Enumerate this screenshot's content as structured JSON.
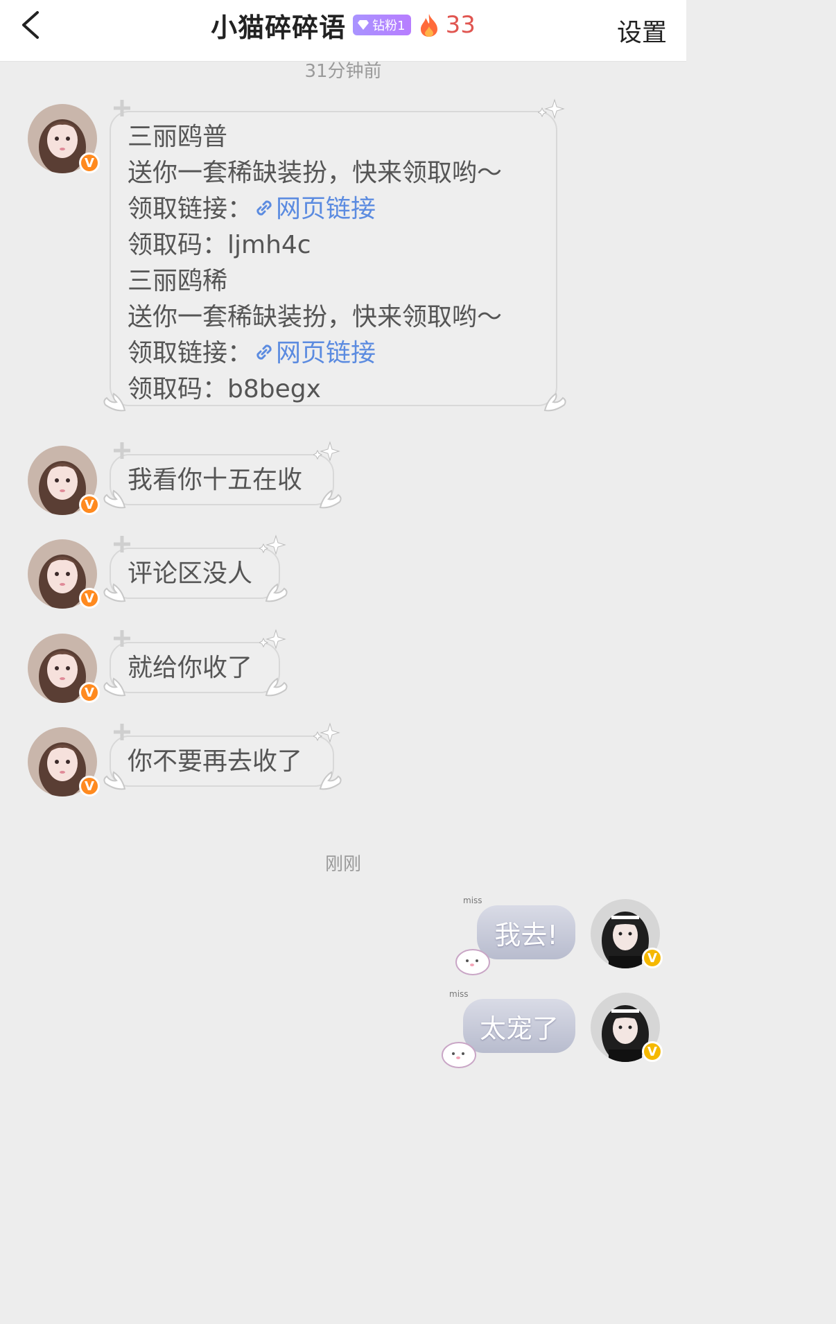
{
  "header": {
    "title": "小猫碎碎语",
    "badge": "钻粉1",
    "streak": "33",
    "settings": "设置"
  },
  "time_labels": [
    "31分钟前",
    "刚刚"
  ],
  "messages": {
    "m1": {
      "lines": [
        "三丽鸥普",
        "送你一套稀缺装扮，快来领取哟～",
        "领取链接：",
        "领取码：ljmh4c",
        "三丽鸥稀",
        "送你一套稀缺装扮，快来领取哟～",
        "领取链接：",
        "领取码：b8begx"
      ],
      "link_text": "网页链接"
    },
    "m2": "我看你十五在收",
    "m3": "评论区没人",
    "m4": "就给你收了",
    "m5": "你不要再去收了",
    "o1": "我去!",
    "o2": "太宠了"
  },
  "decor": {
    "miss": "miss",
    "v": "V"
  }
}
